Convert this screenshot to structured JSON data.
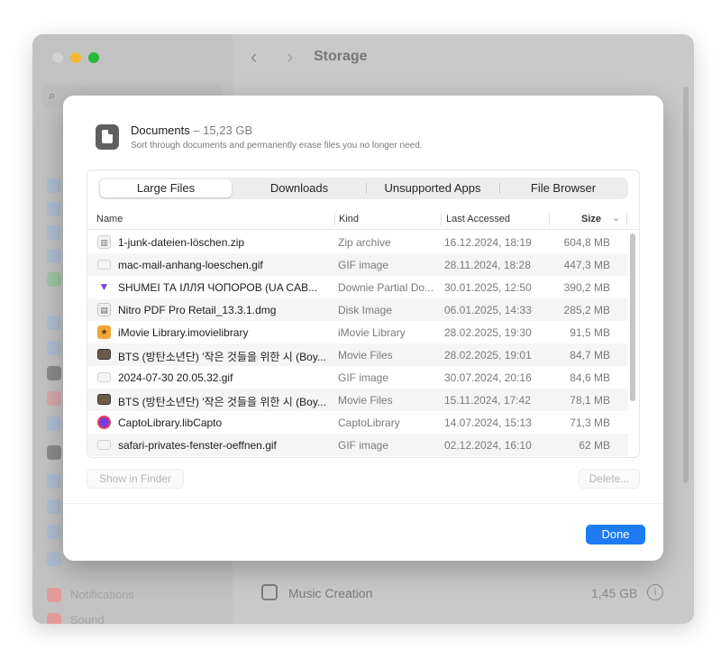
{
  "window": {
    "toolbar_title": "Storage",
    "sidebar_items": [
      "Notifications",
      "Sound"
    ]
  },
  "background_row": {
    "label": "Music Creation",
    "size": "1,45 GB"
  },
  "sheet": {
    "title": "Documents",
    "title_size": " – 15,23 GB",
    "subtitle": "Sort through documents and permanently erase files you no longer need.",
    "tabs": [
      {
        "label": "Large Files",
        "active": true
      },
      {
        "label": "Downloads",
        "active": false
      },
      {
        "label": "Unsupported Apps",
        "active": false
      },
      {
        "label": "File Browser",
        "active": false
      }
    ],
    "columns": {
      "name": "Name",
      "kind": "Kind",
      "last_accessed": "Last Accessed",
      "size": "Size"
    },
    "rows": [
      {
        "name": "1-junk-dateien-löschen.zip",
        "kind": "Zip archive",
        "date": "16.12.2024, 18:19",
        "size": "604,8 MB",
        "icon": "zip-icon"
      },
      {
        "name": "mac-mail-anhang-loeschen.gif",
        "kind": "GIF image",
        "date": "28.11.2024, 18:28",
        "size": "447,3 MB",
        "icon": "gif-icon"
      },
      {
        "name": "SHUMEI ТА ІЛЛЯ ЧОПОРОВ (UA CAB...",
        "kind": "Downie Partial Do...",
        "date": "30.01.2025, 12:50",
        "size": "390,2 MB",
        "icon": "downie-icon"
      },
      {
        "name": "Nitro PDF Pro Retail_13.3.1.dmg",
        "kind": "Disk Image",
        "date": "06.01.2025, 14:33",
        "size": "285,2 MB",
        "icon": "dmg-icon"
      },
      {
        "name": "iMovie Library.imovielibrary",
        "kind": "iMovie Library",
        "date": "28.02.2025, 19:30",
        "size": "91,5 MB",
        "icon": "imovie-icon"
      },
      {
        "name": "BTS (방탄소년단) '작은 것들을 위한 시 (Boy...",
        "kind": "Movie Files",
        "date": "28.02.2025, 19:01",
        "size": "84,7 MB",
        "icon": "movie-icon"
      },
      {
        "name": "2024-07-30 20.05.32.gif",
        "kind": "GIF image",
        "date": "30.07.2024, 20:16",
        "size": "84,6 MB",
        "icon": "gif-icon"
      },
      {
        "name": "BTS (방탄소년단) '작은 것들을 위한 시 (Boy...",
        "kind": "Movie Files",
        "date": "15.11.2024, 17:42",
        "size": "78,1 MB",
        "icon": "movie-icon"
      },
      {
        "name": "CaptoLibrary.libCapto",
        "kind": "CaptoLibrary",
        "date": "14.07.2024, 15:13",
        "size": "71,3 MB",
        "icon": "capto-icon"
      },
      {
        "name": "safari-privates-fenster-oeffnen.gif",
        "kind": "GIF image",
        "date": "02.12.2024, 16:10",
        "size": "62 MB",
        "icon": "gif-icon"
      }
    ],
    "buttons": {
      "show_in_finder": "Show in Finder",
      "delete": "Delete...",
      "done": "Done"
    }
  },
  "colors": {
    "accent": "#1d7cf2",
    "window_bg": "#c9c9c9",
    "traffic_yellow": "#f2b632",
    "traffic_green": "#29b83b"
  }
}
